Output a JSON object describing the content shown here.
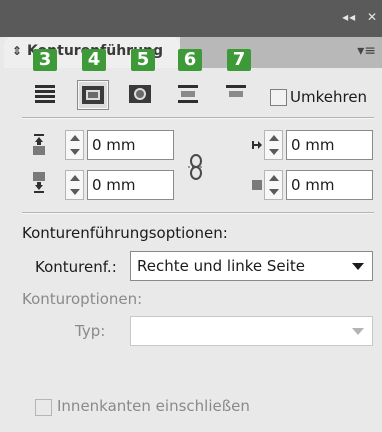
{
  "window": {
    "collapse_label": "◂◂",
    "close_label": "✕"
  },
  "tab": {
    "label": "Konturenführung"
  },
  "badges": [
    "3",
    "4",
    "5",
    "6",
    "7"
  ],
  "wrap_icons": [
    {
      "name": "no-wrap-icon",
      "selected": false
    },
    {
      "name": "wrap-around-bounding-box-icon",
      "selected": true
    },
    {
      "name": "wrap-around-object-shape-icon",
      "selected": false
    },
    {
      "name": "jump-object-icon",
      "selected": false
    },
    {
      "name": "jump-to-next-column-icon",
      "selected": false
    }
  ],
  "invert": {
    "label": "Umkehren",
    "checked": false
  },
  "offsets": {
    "top": "0 mm",
    "bottom": "0 mm",
    "left": "0 mm",
    "right": "0 mm"
  },
  "wrap_options": {
    "heading": "Konturenführungsoptionen:",
    "wrap_to_label": "Konturenf.:",
    "wrap_to_value": "Rechte und linke Seite"
  },
  "contour_options": {
    "heading": "Konturoptionen:",
    "type_label": "Typ:",
    "type_value": ""
  },
  "inside_edges": {
    "label": "Innenkanten einschließen",
    "checked": false,
    "enabled": false
  },
  "colors": {
    "titlebar": "#5a5a5a",
    "panel": "#e9e9e9",
    "badge": "#3e9a39"
  }
}
